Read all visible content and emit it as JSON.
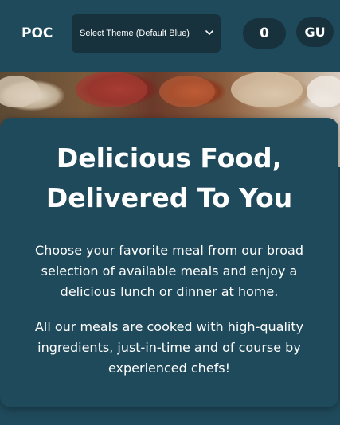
{
  "header": {
    "logo": "POC",
    "theme_select": {
      "selected": "Select Theme (Default Blue)"
    },
    "cart_count": "0",
    "user_initials": "GU"
  },
  "hero": {
    "title_line1": "Delicious Food,",
    "title_line2": "Delivered To You",
    "paragraph1": "Choose your favorite meal from our broad selection of available meals and enjoy a delicious lunch or dinner at home.",
    "paragraph2": "All our meals are cooked with high-quality ingredients, just-in-time and of course by experienced chefs!"
  },
  "colors": {
    "primary_bg": "#1f4a5b",
    "control_bg": "#17323c",
    "text": "#ffffff"
  },
  "icons": {
    "theme_select": "chevron-down-icon"
  }
}
